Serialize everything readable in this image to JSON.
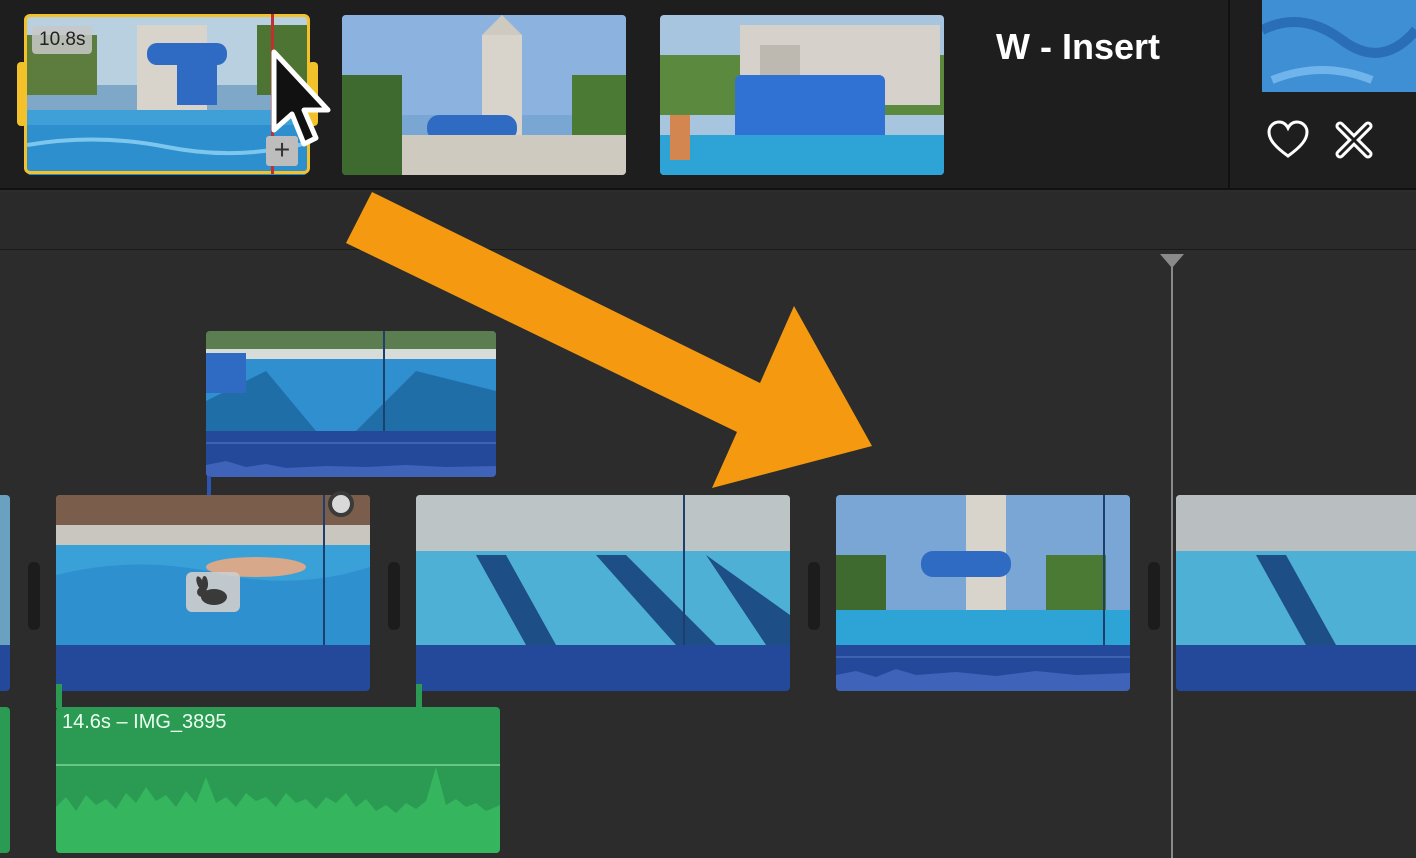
{
  "browser": {
    "selected_clip_duration": "10.8s",
    "insert_hint": "W - Insert",
    "favorite_icon": "heart-icon",
    "reject_icon": "reject-x-icon",
    "add_icon": "plus-icon"
  },
  "timeline": {
    "audio_clip_label": "14.6s – IMG_3895",
    "speed_icon": "rabbit-icon"
  },
  "colors": {
    "selection": "#f3c22a",
    "arrow": "#f59a10",
    "audio_track": "#2b9a52",
    "clip_audio": "#24489a"
  }
}
